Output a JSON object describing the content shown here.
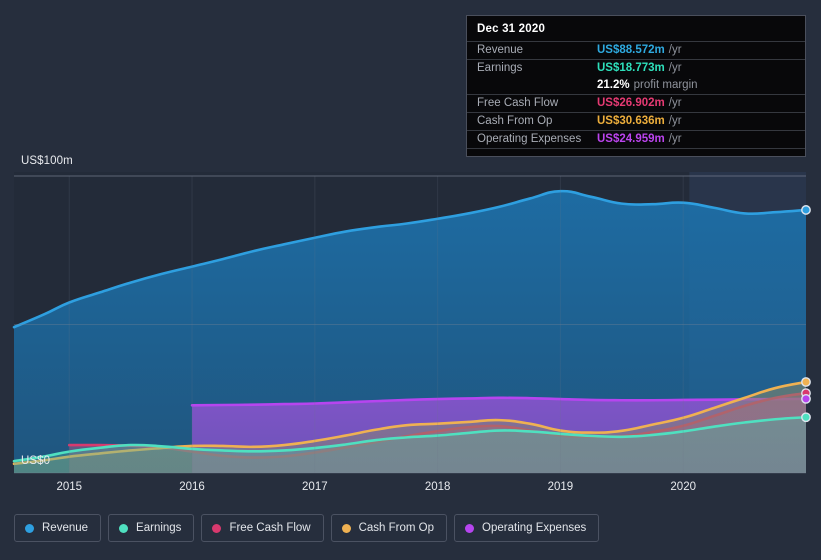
{
  "axis": {
    "y_top_label": "US$100m",
    "y_zero_label": "US$0",
    "x_ticks": [
      "2015",
      "2016",
      "2017",
      "2018",
      "2019",
      "2020"
    ]
  },
  "tooltip": {
    "date": "Dec 31 2020",
    "rows": [
      {
        "key": "Revenue",
        "value": "US$88.572m",
        "unit": "/yr",
        "color": "#2eaae0"
      },
      {
        "key": "Earnings",
        "value": "US$18.773m",
        "unit": "/yr",
        "color": "#2ee0bb"
      },
      {
        "key": "Free Cash Flow",
        "value": "US$26.902m",
        "unit": "/yr",
        "color": "#e63a73"
      },
      {
        "key": "Cash From Op",
        "value": "US$30.636m",
        "unit": "/yr",
        "color": "#edae3c"
      },
      {
        "key": "Operating Expenses",
        "value": "US$24.959m",
        "unit": "/yr",
        "color": "#bb44ee"
      }
    ],
    "margin_value": "21.2%",
    "margin_text": "profit margin"
  },
  "legend": {
    "items": [
      {
        "label": "Revenue",
        "color": "#2e9fe0"
      },
      {
        "label": "Earnings",
        "color": "#4fe0c0"
      },
      {
        "label": "Free Cash Flow",
        "color": "#d8396e"
      },
      {
        "label": "Cash From Op",
        "color": "#efb152"
      },
      {
        "label": "Operating Expenses",
        "color": "#b645ef"
      }
    ]
  },
  "chart_data": {
    "type": "area",
    "title": "",
    "xlabel": "",
    "ylabel": "US$",
    "ylim": [
      0,
      100
    ],
    "yticks": [
      0,
      50,
      100
    ],
    "ytick_labels": [
      "US$0",
      "",
      "US$100m"
    ],
    "grid": true,
    "legend_position": "bottom",
    "x": [
      2014.55,
      2014.8,
      2015.0,
      2015.25,
      2015.5,
      2015.75,
      2016.0,
      2016.25,
      2016.5,
      2016.75,
      2017.0,
      2017.25,
      2017.5,
      2017.75,
      2018.0,
      2018.25,
      2018.5,
      2018.75,
      2019.0,
      2019.25,
      2019.5,
      2019.75,
      2020.0,
      2020.25,
      2020.5,
      2020.75,
      2021.0
    ],
    "xtick_values": [
      2015,
      2016,
      2017,
      2018,
      2019,
      2020
    ],
    "forecast_band_start": 2020.05,
    "units": "US$ millions per year",
    "series": [
      {
        "name": "Revenue",
        "color": "#2e9fe0",
        "values": [
          49.1,
          53.5,
          57.4,
          60.8,
          64.1,
          67.0,
          69.5,
          72.0,
          74.7,
          77.0,
          79.2,
          81.3,
          82.8,
          84.0,
          85.6,
          87.4,
          89.6,
          92.4,
          94.9,
          93.0,
          90.7,
          90.5,
          91.0,
          89.3,
          87.4,
          87.8,
          88.572
        ]
      },
      {
        "name": "Earnings",
        "color": "#4fe0c0",
        "values": [
          4.0,
          5.6,
          7.2,
          8.5,
          9.4,
          9.0,
          8.1,
          7.6,
          7.3,
          7.6,
          8.4,
          9.6,
          11.1,
          12.0,
          12.6,
          13.5,
          14.3,
          14.0,
          13.2,
          12.5,
          12.2,
          12.8,
          14.0,
          15.6,
          17.0,
          18.1,
          18.773
        ]
      },
      {
        "name": "Free Cash Flow",
        "color": "#d8396e",
        "values": [
          null,
          null,
          9.4,
          9.4,
          9.2,
          8.6,
          7.2,
          5.8,
          5.2,
          5.6,
          6.9,
          8.6,
          10.4,
          12.4,
          14.1,
          15.4,
          15.8,
          14.3,
          12.6,
          12.2,
          12.4,
          13.8,
          15.9,
          19.2,
          22.6,
          25.3,
          26.902
        ]
      },
      {
        "name": "Cash From Op",
        "color": "#efb152",
        "values": [
          3.1,
          4.3,
          5.5,
          6.6,
          7.6,
          8.4,
          9.1,
          9.1,
          8.8,
          9.4,
          10.8,
          12.6,
          14.6,
          16.1,
          16.6,
          17.2,
          17.8,
          16.6,
          14.3,
          13.6,
          14.2,
          16.3,
          18.6,
          21.9,
          25.3,
          28.6,
          30.636
        ]
      },
      {
        "name": "Operating Expenses",
        "color": "#b645ef",
        "values": [
          null,
          null,
          null,
          null,
          null,
          null,
          22.8,
          22.9,
          23.0,
          23.2,
          23.4,
          23.8,
          24.2,
          24.6,
          24.9,
          25.1,
          25.3,
          25.2,
          24.9,
          24.6,
          24.5,
          24.5,
          24.6,
          24.7,
          24.8,
          24.9,
          24.959
        ]
      }
    ]
  }
}
